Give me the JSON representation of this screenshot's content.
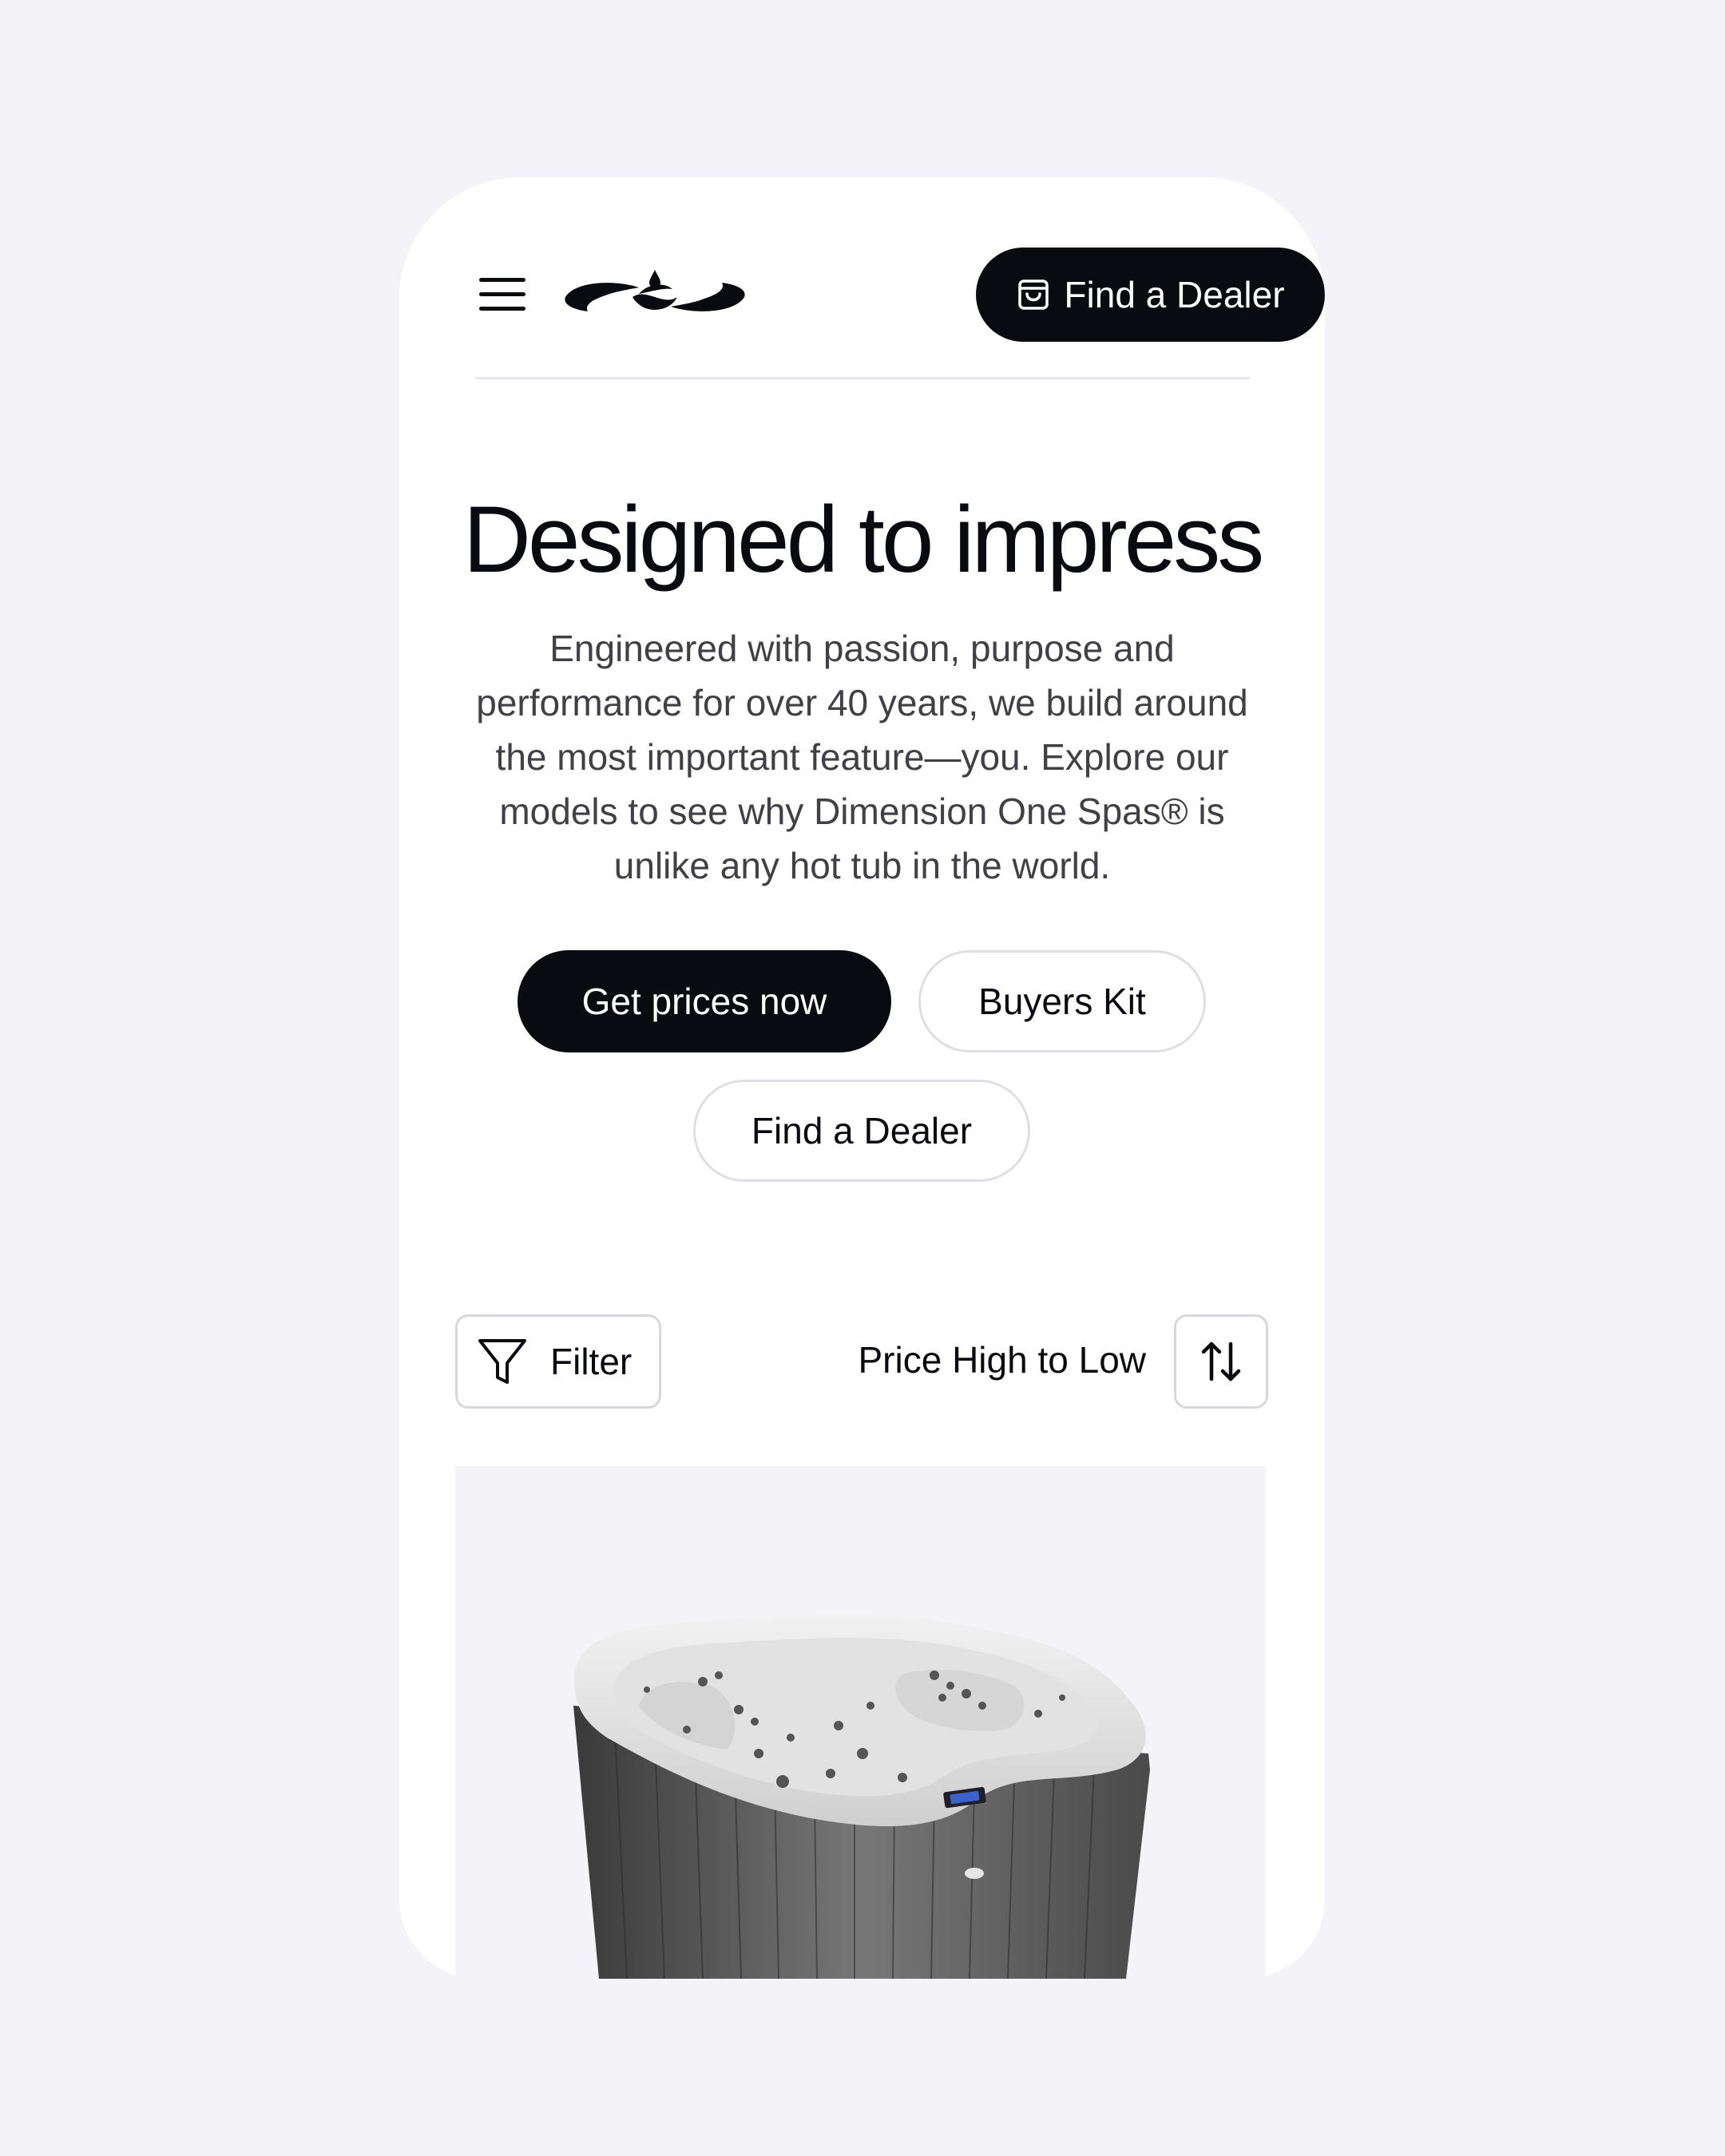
{
  "header": {
    "menu_icon": "hamburger-menu-icon",
    "logo_icon": "dimension-one-logo",
    "cta_icon": "shopping-bag-icon",
    "cta_label": "Find a Dealer"
  },
  "hero": {
    "title": "Designed to impress",
    "description": "Engineered with passion, purpose and performance for over 40 years, we build around the most important feature—you. Explore our models to see why Dimension One Spas® is unlike any hot tub in the world.",
    "primary_button": "Get prices now",
    "buyers_kit_button": "Buyers Kit",
    "dealer_button": "Find a Dealer"
  },
  "toolbar": {
    "filter_label": "Filter",
    "filter_icon": "funnel-icon",
    "sort_label": "Price High to Low",
    "sort_icon": "sort-arrows-icon"
  },
  "product": {
    "image": "hot-tub-photo"
  },
  "colors": {
    "background": "#f4f3f7",
    "surface": "#ffffff",
    "primary": "#0a0b10",
    "body_text": "#404046",
    "border": "#dfdfe3"
  }
}
